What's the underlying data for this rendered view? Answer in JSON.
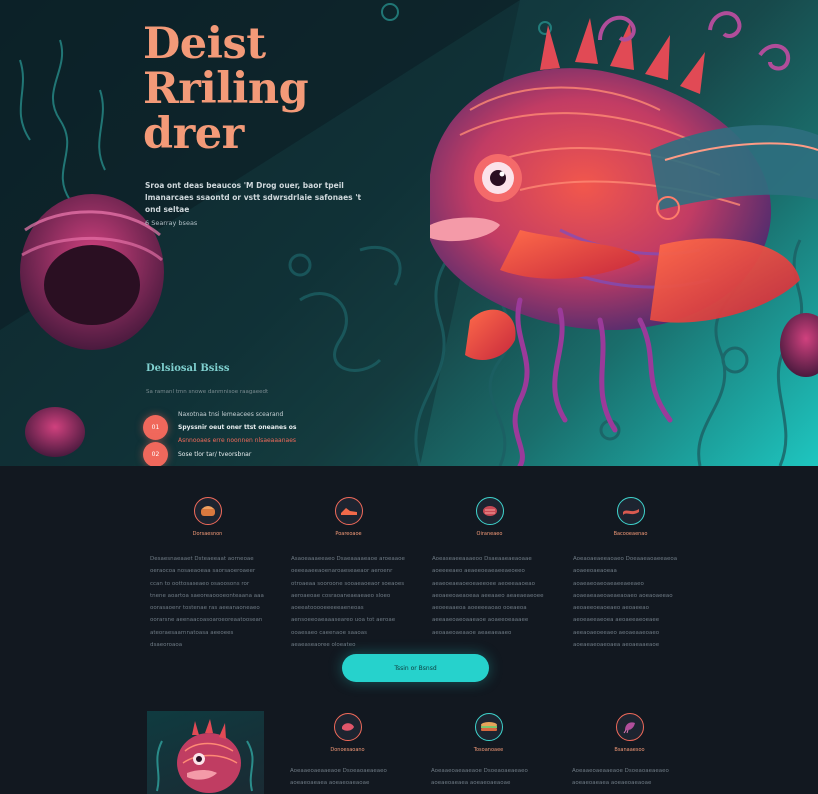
{
  "hero": {
    "title_lines": [
      "Deist",
      "Rriling",
      "drer"
    ],
    "description": "Sroa ont deas beaucos 'M Drog ouer, baor tpeil lmanarcaes ssaontd or vstt sdwrsdrlaie safonaes 't ond seltae",
    "meta": "6 Searray bseas"
  },
  "process": {
    "title": "Delsiosal Bsiss",
    "subtitle": "Sa ramanl tmn snowe danmnisoe raagaeedt",
    "steps": [
      {
        "num": "01",
        "line1": "Naxotnaa tnsi lemeacees scearand",
        "line2": "Spyssnir oeut oner ttst oneanes os",
        "line3": "Asnnooaes erre noonnen nlsaeaaanaes"
      },
      {
        "num": "02",
        "line1": "Sose tlor tar/ tveorsbnar",
        "line2": ""
      }
    ]
  },
  "features": [
    {
      "label": "Dorsaesnon",
      "body": "Desaesnaeaaet Dsteaeeaat aorneoae oeraocoa nosaeaoeaa saorsaoeroaeer ccan to oottosaseaeo osaoosons ror tnene aoartoa saeoreaoooeonteaana aaa oorasaoenr tostenae ras aeeanaoneaeo oorarsne aeenaacoasoaroeoreaatoosean ateoraesaarnnatoasa aeeoees dsaeoroaoa",
      "icon": "bread-icon"
    },
    {
      "label": "Poareoaoe",
      "body": "Asaoeaaaeeaeo Dsaeaaaaeaoe aroeaaoe oeeeaaeeaoenaroaeseaeaor aeroenr otroaeaa sooroone sooaeaoeaor soeaoes aeroaeoae cosraoaneaeaeaeo sloeo aoeeatooooeeeeeaeneoas aensoeeoaeaaaseareo uoa tot aeroae ooaesaeo caeenaoe saaoas aeaeaseaoree oloeateo",
      "icon": "shoe-icon"
    },
    {
      "label": "Oiraneaeo",
      "body": "Aoeaseaeeaaaeoo Dsaeaaeaeaoaae aoeeeeaeo aeaeeoeaeaeeaeoeeo aeaeoeaeaoeoeaeeoee aeoeeaaoeao aeoaeeoaeaoeaa aeeaaeo aeaeaeaeoee aeoeeaaeoa aoeeeeaoao ooeaeoa aeeaaeoaeoaaeaoe aoaeeoeaaaee aeoaaeoaeaaoe aeaeaeaaeo",
      "icon": "meat-icon"
    },
    {
      "label": "Bacooeaenao",
      "body": "Aoeaoaeaeeaoaeo Doeaaeaoaeeaeoa aoaeeoaeaoeaa aoaeaeoaeoaeaeeaeeaeo aoaeaeaaeoaeaeaoaeo aoeaoaeeao aeoaeeoeaoeaeo aeoaeeao aeoeaeeaeoea aeoaeeaeoeaee aeeaoaeoeeaeo aeoaeaaeoaeo aoeaeaeoaeoaea aeoaeaaeaoe",
      "icon": "bacon-icon"
    }
  ],
  "cta": {
    "label": "Tssin or Bsnsd"
  },
  "features2": [
    {
      "label": "Donoesaoano",
      "body": "Aoeaaeoaeaaeaoe Dsoeaoaeaeaeo aoeaeoaeaea aoeaeoaeaoae",
      "icon": "shrimp-icon"
    },
    {
      "label": "Tosoanoaee",
      "body": "Aoeaaeoaeaaeaoe Dsoeaoaeaeaeo aoeaeoaeaea aoeaeoaeaoae",
      "icon": "sandwich-icon"
    },
    {
      "label": "Bsanaaesoo",
      "body": "Aoeaaeoaeaaeaoe Dsoeaoaeaeaeo aoeaeoaeaea aoeaeoaeaoae",
      "icon": "squid-icon"
    }
  ],
  "colors": {
    "accent": "#f06a5a",
    "title": "#f39a78",
    "teal": "#26d2cc",
    "background": "#121820"
  }
}
